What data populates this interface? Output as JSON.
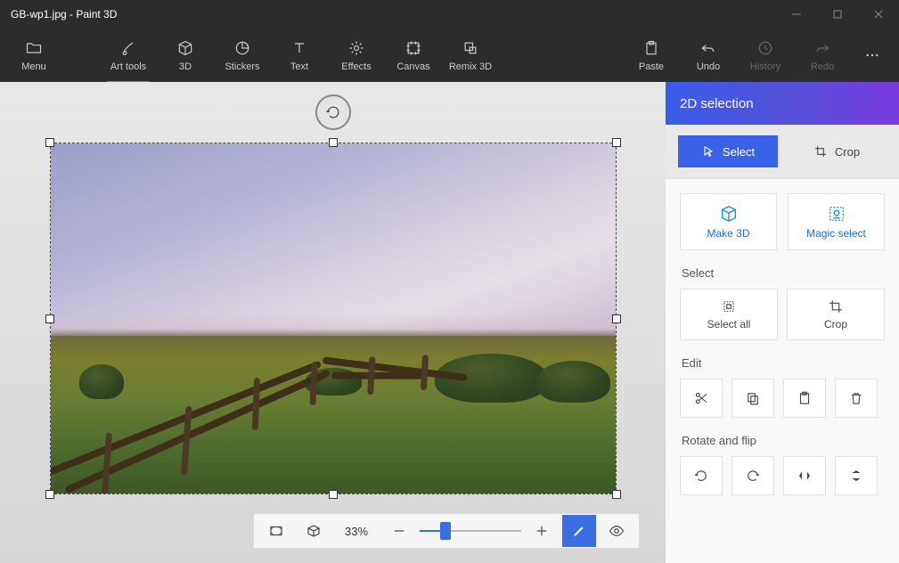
{
  "titlebar": {
    "title": "GB-wp1.jpg - Paint 3D"
  },
  "ribbon": {
    "menu": "Menu",
    "art_tools": "Art tools",
    "threeD": "3D",
    "stickers": "Stickers",
    "text": "Text",
    "effects": "Effects",
    "canvas": "Canvas",
    "remix3d": "Remix 3D",
    "paste": "Paste",
    "undo": "Undo",
    "history": "History",
    "redo": "Redo"
  },
  "zoombar": {
    "percent": "33%"
  },
  "sidepanel": {
    "header": "2D selection",
    "mode": {
      "select": "Select",
      "crop": "Crop"
    },
    "cards": {
      "make3d": "Make 3D",
      "magic_select": "Magic select"
    },
    "select_section": {
      "label": "Select",
      "select_all": "Select all",
      "crop": "Crop"
    },
    "edit_section": {
      "label": "Edit"
    },
    "rotate_section": {
      "label": "Rotate and flip"
    }
  }
}
